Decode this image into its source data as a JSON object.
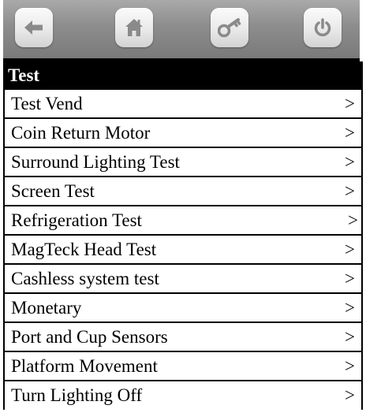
{
  "toolbar": {
    "buttons": [
      {
        "id": "back",
        "icon": "back-arrow-icon"
      },
      {
        "id": "home",
        "icon": "home-icon"
      },
      {
        "id": "key",
        "icon": "key-icon"
      },
      {
        "id": "power",
        "icon": "power-icon"
      }
    ],
    "icon_color": "#8a8a8a"
  },
  "header": {
    "title": "Test"
  },
  "menu": {
    "items": [
      {
        "label": "Test Vend",
        "arrow": ">"
      },
      {
        "label": "Coin Return Motor",
        "arrow": ">"
      },
      {
        "label": "Surround Lighting Test",
        "arrow": ">"
      },
      {
        "label": "Screen Test",
        "arrow": ">"
      },
      {
        "label": "Refrigeration Test",
        "arrow": ">"
      },
      {
        "label": "MagTeck Head Test",
        "arrow": ">"
      },
      {
        "label": "Cashless system test",
        "arrow": ">"
      },
      {
        "label": "Monetary",
        "arrow": ">"
      },
      {
        "label": "Port and Cup Sensors",
        "arrow": ">"
      },
      {
        "label": "Platform Movement",
        "arrow": ">"
      },
      {
        "label": "Turn Lighting Off",
        "arrow": ">"
      }
    ]
  }
}
